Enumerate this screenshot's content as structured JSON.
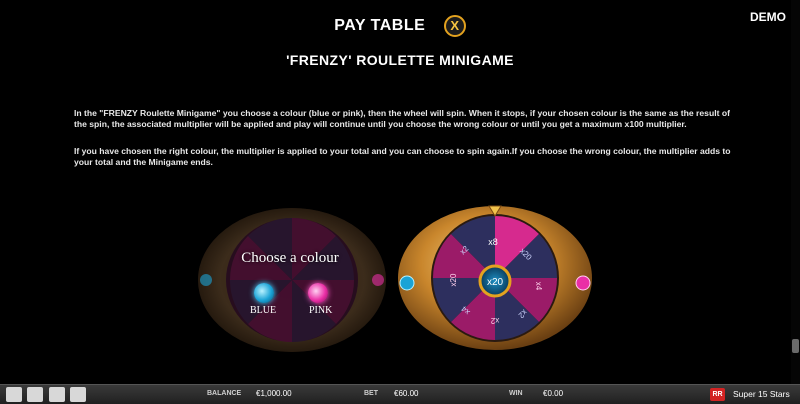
{
  "header": {
    "title": "PAY TABLE",
    "close_label": "X",
    "demo": "DEMO"
  },
  "section": {
    "title": "'FRENZY' ROULETTE MINIGAME"
  },
  "description": {
    "p1": "In the \"FRENZY Roulette Minigame\" you choose a colour (blue or pink), then the wheel will spin. When it stops, if your chosen colour is the same as the result of the spin, the associated multiplier will be applied and play will continue until you choose the wrong colour or until you get a maximum x100 multiplier.",
    "p2": "If you have chosen the right colour, the multiplier is applied to your total and you can choose to spin again.If you choose the wrong colour, the multiplier adds to your total and the Minigame ends."
  },
  "left_wheel": {
    "prompt": "Choose a colour",
    "blue_label": "BLUE",
    "pink_label": "PINK"
  },
  "right_wheel": {
    "center": "x20",
    "segments": [
      "x8",
      "x20",
      "x4",
      "x2",
      "x2",
      "x4",
      "x20",
      "x2"
    ]
  },
  "bottom_bar": {
    "balance_label": "BALANCE",
    "balance_value": "€1,000.00",
    "bet_label": "BET",
    "bet_value": "€60.00",
    "win_label": "WIN",
    "win_value": "€0.00",
    "game_name": "Super 15 Stars",
    "logo_text": "RR"
  },
  "colors": {
    "accent_gold": "#e3a21f",
    "blue": "#1aa3d6",
    "pink": "#ea2fa6",
    "wheel_segment": "#8b1a5e"
  }
}
